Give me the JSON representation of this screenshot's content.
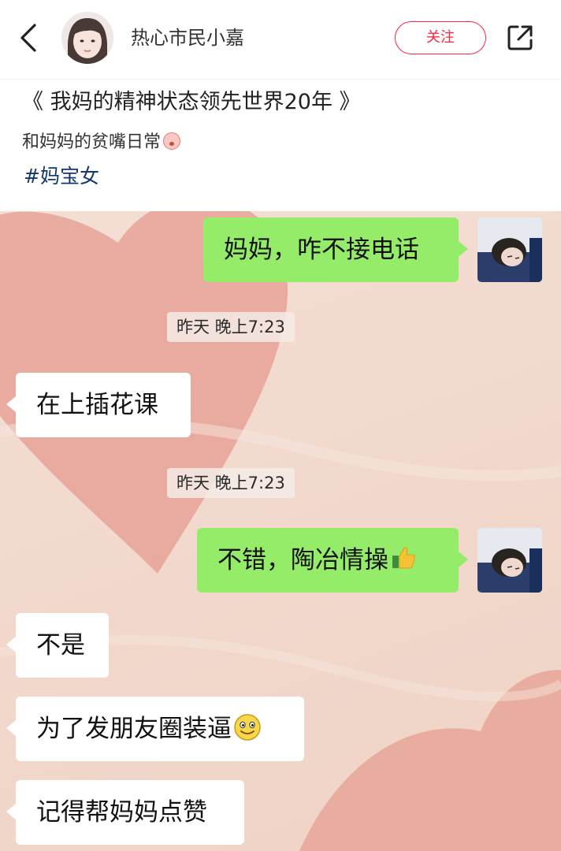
{
  "header": {
    "author_name": "热心市民小嘉",
    "follow_label": "关注"
  },
  "note": {
    "title": "《 我妈的精神状态领先世界20年 》",
    "description": "和妈妈的贫嘴日常",
    "tag": "#妈宝女"
  },
  "chat": {
    "messages": [
      {
        "side": "right",
        "text": "妈妈，咋不接电话"
      },
      {
        "type": "time",
        "text": "昨天 晚上7:23"
      },
      {
        "side": "left",
        "text": "在上插花课"
      },
      {
        "type": "time",
        "text": "昨天 晚上7:23"
      },
      {
        "side": "right",
        "text": "不错，陶冶情操"
      },
      {
        "side": "left",
        "text": "不是"
      },
      {
        "side": "left",
        "text": "为了发朋友圈装逼"
      },
      {
        "side": "left",
        "text": "记得帮妈妈点赞"
      }
    ]
  },
  "colors": {
    "accent": "#ff2442",
    "tag": "#13386c",
    "sent_bubble": "#95ec69",
    "received_bubble": "#ffffff",
    "chat_background": "#f2d9cd",
    "heart": "#e3988c"
  },
  "icons": {
    "back": "chevron-left-icon",
    "share": "share-icon",
    "thumbs": "thumbs-up-emoji",
    "smile": "smile-emoji",
    "face": "crying-face-emoji"
  }
}
